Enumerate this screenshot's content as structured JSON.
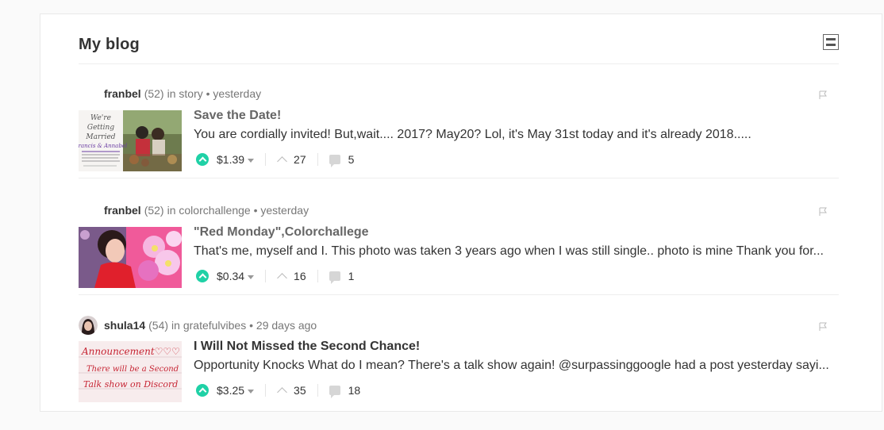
{
  "page": {
    "title": "My blog",
    "accent_color": "#1fd1a6"
  },
  "posts": [
    {
      "author": "franbel",
      "reputation": "(52)",
      "category_prefix": "in",
      "category": "story",
      "time": "• yesterday",
      "title": "Save the Date!",
      "excerpt": "You are cordially invited! But,wait.... 2017? May20? Lol, it's May 31st today and it's already 2018.....",
      "payout": "$1.39",
      "votes": "27",
      "comments": "5",
      "thumb_text": [
        "We're",
        "Getting",
        "Married",
        "Francis & Annabel"
      ]
    },
    {
      "author": "franbel",
      "reputation": "(52)",
      "category_prefix": "in",
      "category": "colorchallenge",
      "time": "• yesterday",
      "title": "\"Red Monday\",Colorchallege",
      "excerpt": "That's me, myself and I. This photo was taken 3 years ago when I was still single.. photo is mine Thank you for...",
      "payout": "$0.34",
      "votes": "16",
      "comments": "1"
    },
    {
      "author": "shula14",
      "reputation": "(54)",
      "category_prefix": "in",
      "category": "gratefulvibes",
      "time": "• 29 days ago",
      "title": "I Will Not Missed the Second Chance!",
      "excerpt": "Opportunity Knocks What do I mean? There's a talk show again! @surpassinggoogle had a post yesterday sayi...",
      "payout": "$3.25",
      "votes": "35",
      "comments": "18",
      "thumb_text": [
        "Announcement♡♡♡",
        "There will be a Second",
        "Talk show on Discord"
      ]
    }
  ]
}
